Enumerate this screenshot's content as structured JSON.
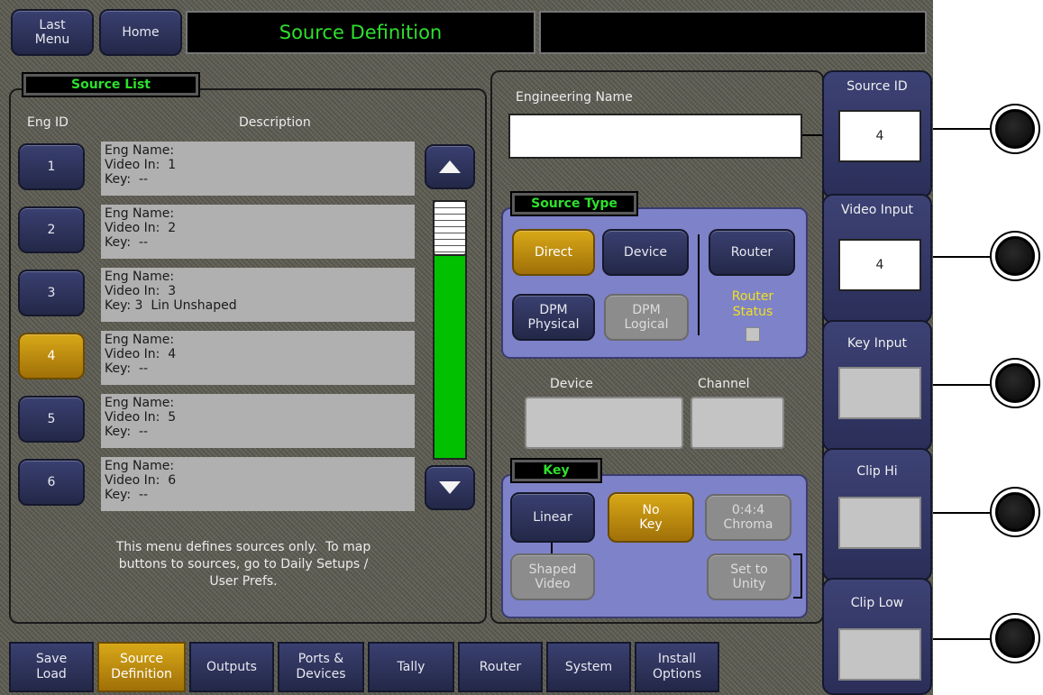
{
  "header": {
    "last_menu": "Last\nMenu",
    "home": "Home",
    "title": "Source Definition",
    "status": ""
  },
  "source_list": {
    "tag": "Source List",
    "col_id": "Eng ID",
    "col_desc": "Description",
    "rows": [
      {
        "id": "1",
        "text": "Eng Name:\nVideo In:  1\nKey:  --"
      },
      {
        "id": "2",
        "text": "Eng Name:\nVideo In:  2\nKey:  --"
      },
      {
        "id": "3",
        "text": "Eng Name:\nVideo In:  3\nKey: 3  Lin Unshaped"
      },
      {
        "id": "4",
        "text": "Eng Name:\nVideo In:  4\nKey:  --"
      },
      {
        "id": "5",
        "text": "Eng Name:\nVideo In:  5\nKey:  --"
      },
      {
        "id": "6",
        "text": "Eng Name:\nVideo In:  6\nKey:  --"
      }
    ],
    "note": "This menu defines sources only.  To map\nbuttons to sources, go to Daily Setups /\nUser Prefs."
  },
  "engineering": {
    "label": "Engineering Name",
    "value": ""
  },
  "source_type": {
    "tag": "Source Type",
    "direct": "Direct",
    "device": "Device",
    "router": "Router",
    "dpm_physical": "DPM\nPhysical",
    "dpm_logical": "DPM\nLogical",
    "router_status": "Router\nStatus"
  },
  "device_label": "Device",
  "channel_label": "Channel",
  "key": {
    "tag": "Key",
    "linear": "Linear",
    "no_key": "No\nKey",
    "chroma": "0:4:4\nChroma",
    "shaped": "Shaped\nVideo",
    "unity": "Set to\nUnity"
  },
  "right_panels": {
    "source_id": {
      "label": "Source ID",
      "value": "4"
    },
    "video_input": {
      "label": "Video Input",
      "value": "4"
    },
    "key_input": {
      "label": "Key Input"
    },
    "clip_hi": {
      "label": "Clip Hi"
    },
    "clip_low": {
      "label": "Clip Low"
    }
  },
  "tabs": [
    {
      "label": "Save\nLoad"
    },
    {
      "label": "Source\nDefinition"
    },
    {
      "label": "Outputs"
    },
    {
      "label": "Ports &\nDevices"
    },
    {
      "label": "Tally"
    },
    {
      "label": "Router"
    },
    {
      "label": "System"
    },
    {
      "label": "Install\nOptions"
    }
  ],
  "colors": {
    "accent_green": "#2ee02e",
    "selected_gold": "#d8a818",
    "scroll_green": "#00c000",
    "router_status_text": "#f0e020"
  }
}
